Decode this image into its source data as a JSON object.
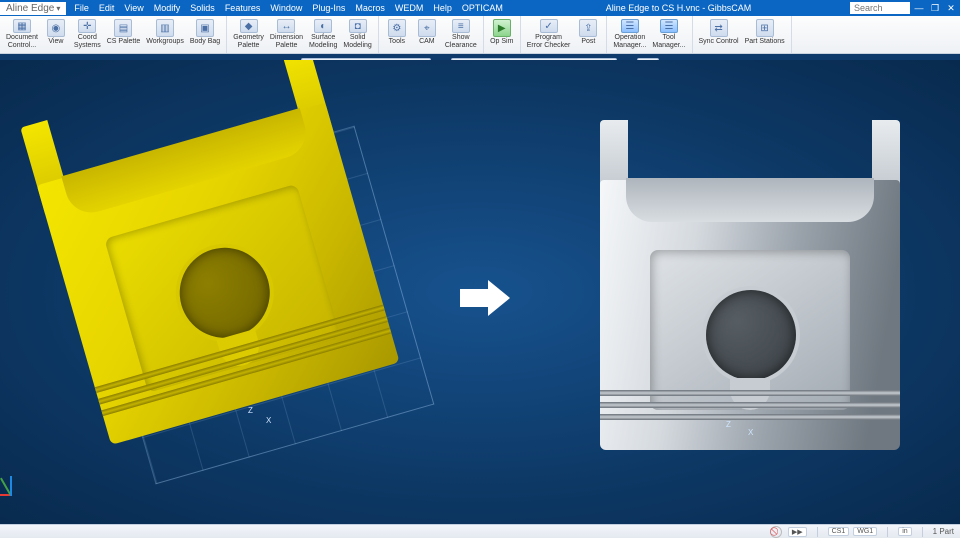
{
  "titlebar": {
    "brand": "Aline Edge",
    "dropdown_glyph": "▾",
    "menu": [
      "File",
      "Edit",
      "View",
      "Modify",
      "Solids",
      "Features",
      "Window",
      "Plug-Ins",
      "Macros",
      "WEDM",
      "Help",
      "OPTICAM"
    ],
    "center": "Aline Edge to CS H.vnc - GibbsCAM",
    "search_placeholder": "Search",
    "min": "—",
    "restore": "❐",
    "close": "✕"
  },
  "ribbon": {
    "groups": [
      {
        "items": [
          {
            "label": "Document\nControl..."
          },
          {
            "label": "View"
          },
          {
            "label": "Coord\nSystems"
          },
          {
            "label": "CS Palette"
          },
          {
            "label": "Workgroups"
          },
          {
            "label": "Body Bag"
          }
        ]
      },
      {
        "items": [
          {
            "label": "Geometry\nPalette"
          },
          {
            "label": "Dimension\nPalette"
          },
          {
            "label": "Surface\nModeling"
          },
          {
            "label": "Solid\nModeling"
          }
        ]
      },
      {
        "items": [
          {
            "label": "Tools"
          },
          {
            "label": "CAM"
          },
          {
            "label": "Show\nClearance"
          }
        ]
      },
      {
        "items": [
          {
            "label": "Op Sim",
            "variant": "green"
          }
        ]
      },
      {
        "items": [
          {
            "label": "Program\nError Checker"
          },
          {
            "label": "Post"
          }
        ]
      },
      {
        "items": [
          {
            "label": "Operation\nManager..."
          },
          {
            "label": "Tool\nManager..."
          }
        ]
      },
      {
        "items": [
          {
            "label": "Sync Control"
          },
          {
            "label": "Part Stations"
          }
        ]
      }
    ]
  },
  "floatbar": {
    "group1_count": 7,
    "group2_count": 9,
    "group3_count": 1
  },
  "viewport": {
    "axis_left": {
      "z": "Z",
      "x": "X"
    },
    "axis_right": {
      "z": "Z",
      "x": "X"
    }
  },
  "statusbar": {
    "play": "▶▶",
    "cs": "CS1",
    "wg": "WG1",
    "inch": "in",
    "part": "1 Part"
  }
}
